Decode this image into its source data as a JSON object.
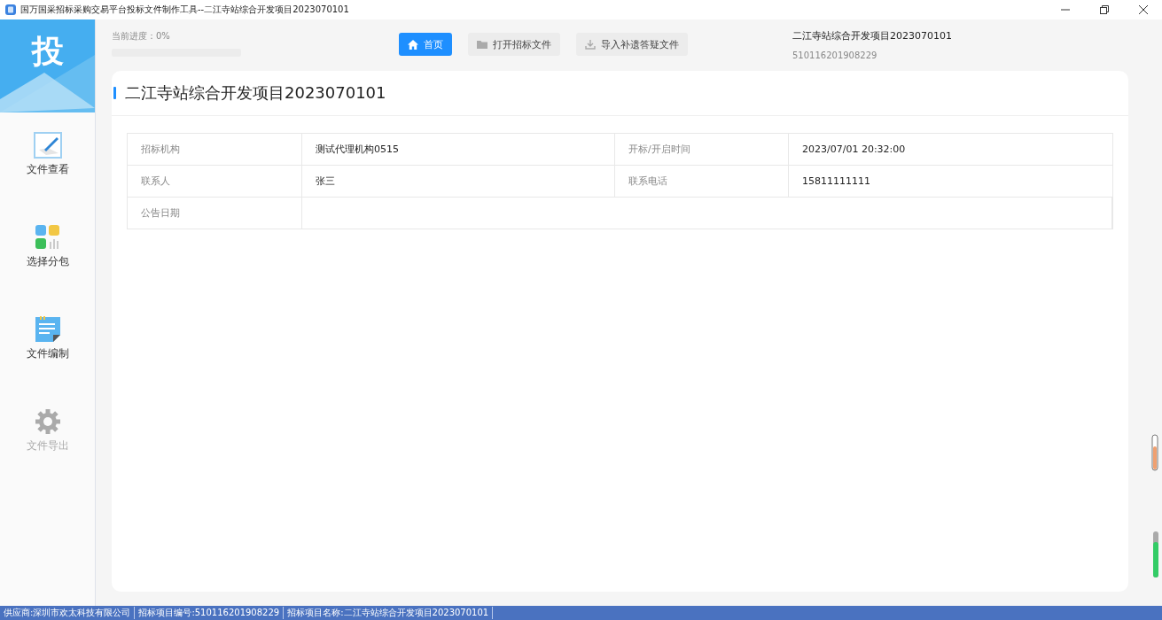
{
  "window": {
    "title": "国万国采招标采购交易平台投标文件制作工具--二江寺站综合开发项目2023070101"
  },
  "logo": {
    "text": "投"
  },
  "sidebar": {
    "items": [
      {
        "label": "文件查看",
        "kind": "view",
        "disabled": false
      },
      {
        "label": "选择分包",
        "kind": "package",
        "disabled": false
      },
      {
        "label": "文件编制",
        "kind": "edit",
        "disabled": false
      },
      {
        "label": "文件导出",
        "kind": "export",
        "disabled": true
      }
    ]
  },
  "progress": {
    "label": "当前进度：0%",
    "level": 0
  },
  "toolbar": {
    "buttons": [
      {
        "label": "首页",
        "kind": "home",
        "selected": true
      },
      {
        "label": "打开招标文件",
        "kind": "folder",
        "selected": false
      },
      {
        "label": "导入补遗答疑文件",
        "kind": "import",
        "selected": false
      }
    ]
  },
  "project": {
    "name": "二江寺站综合开发项目2023070101",
    "code": "510116201908229"
  },
  "card": {
    "title": "二江寺站综合开发项目2023070101",
    "rows": [
      {
        "cells": [
          "招标机构",
          "测试代理机构0515",
          "开标/开启时间",
          "2023/07/01 20:32:00"
        ]
      },
      {
        "cells": [
          "联系人",
          "张三",
          "联系电话",
          "15811111111"
        ]
      },
      {
        "cells": [
          "公告日期",
          ""
        ]
      }
    ]
  },
  "status_bar": {
    "items": [
      "供应商:深圳市欢太科技有限公司",
      "招标项目编号:510116201908229",
      "招标项目名称:二江寺站综合开发项目2023070101"
    ]
  }
}
